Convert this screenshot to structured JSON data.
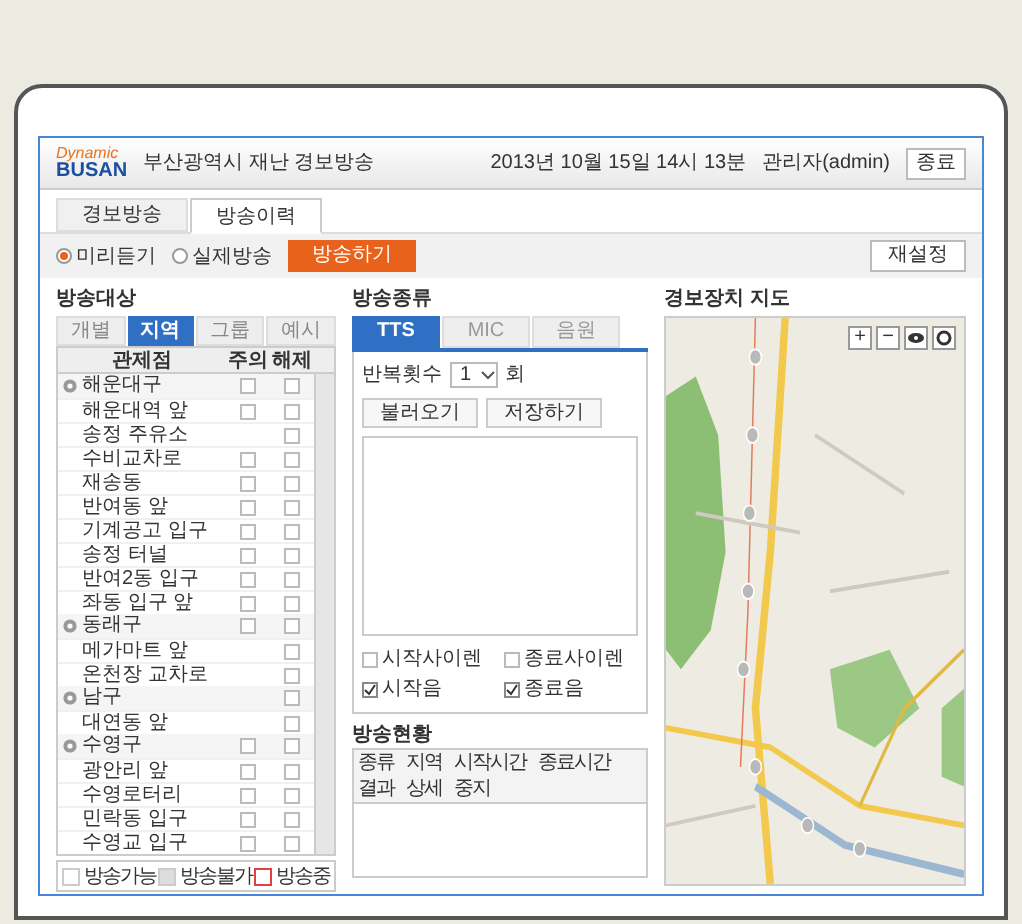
{
  "header": {
    "logo_top": "Dynamic",
    "logo_bottom": "BUSAN",
    "title": "부산광역시 재난 경보방송",
    "datetime": "2013년 10월 15일 14시 13분",
    "user": "관리자(admin)",
    "exit_button": "종료"
  },
  "tabs": [
    {
      "label": "경보방송",
      "selected": false
    },
    {
      "label": "방송이력",
      "selected": true
    }
  ],
  "mode_options": [
    {
      "label": "미리듣기",
      "selected": true
    },
    {
      "label": "실제방송",
      "selected": false
    }
  ],
  "broadcast_button": "방송하기",
  "reset_button": "재설정",
  "target": {
    "title": "방송대상",
    "tabs": [
      {
        "label": "개별",
        "selected": false
      },
      {
        "label": "지역",
        "selected": true
      },
      {
        "label": "그룹",
        "selected": false
      },
      {
        "label": "예시",
        "selected": false
      }
    ],
    "columns": [
      "관제점",
      "주의",
      "해제"
    ],
    "groups": [
      {
        "label": "해운대구",
        "checks": [
          false,
          false
        ],
        "children": [
          {
            "label": "해운대역 앞",
            "checks": [
              false,
              false
            ]
          },
          {
            "label": "송정 주유소",
            "checks": [
              false
            ]
          },
          {
            "label": "수비교차로",
            "checks": [
              false,
              false
            ]
          },
          {
            "label": "재송동",
            "checks": [
              false,
              false
            ]
          },
          {
            "label": "반여동 앞",
            "checks": [
              false,
              false
            ]
          },
          {
            "label": "기계공고 입구",
            "checks": [
              false,
              false
            ]
          },
          {
            "label": "송정 터널",
            "checks": [
              false,
              false
            ]
          },
          {
            "label": "반여2동 입구",
            "checks": [
              false,
              false
            ]
          },
          {
            "label": "좌동 입구 앞",
            "checks": [
              false,
              false
            ]
          }
        ]
      },
      {
        "label": "동래구",
        "checks": [
          false,
          false
        ],
        "children": [
          {
            "label": "메가마트 앞",
            "checks": [
              false
            ]
          },
          {
            "label": "온천장 교차로",
            "checks": [
              false
            ]
          }
        ]
      },
      {
        "label": "남구",
        "checks": [
          false
        ],
        "children": [
          {
            "label": "대연동 앞",
            "checks": [
              false
            ]
          }
        ]
      },
      {
        "label": "수영구",
        "checks": [
          false,
          false
        ],
        "children": [
          {
            "label": "광안리 앞",
            "checks": [
              false,
              false
            ]
          },
          {
            "label": "수영로터리",
            "checks": [
              false,
              false
            ]
          },
          {
            "label": "민락동 입구",
            "checks": [
              false,
              false
            ]
          },
          {
            "label": "수영교 입구",
            "checks": [
              false,
              false
            ]
          }
        ]
      }
    ]
  },
  "legend": [
    {
      "label": "방송가능",
      "kind": "fill",
      "color": "#ffffff"
    },
    {
      "label": "방송불가",
      "kind": "fill",
      "color": "#dddddd"
    },
    {
      "label": "방송중",
      "kind": "outline",
      "color": "#e04040"
    }
  ],
  "type": {
    "title": "방송종류",
    "tabs": [
      {
        "label": "TTS",
        "selected": true
      },
      {
        "label": "MIC",
        "selected": false
      },
      {
        "label": "음원",
        "selected": false
      }
    ],
    "repeat_label": "반복횟수",
    "repeat_value": "1",
    "repeat_unit": "회",
    "buttons": [
      "불러오기",
      "저장하기"
    ],
    "options": [
      {
        "label": "시작사이렌",
        "checked": false
      },
      {
        "label": "종료사이렌",
        "checked": false
      },
      {
        "label": "시작음",
        "checked": true
      },
      {
        "label": "종료음",
        "checked": true
      }
    ]
  },
  "status": {
    "title": "방송현황",
    "columns": [
      "종류",
      "지역",
      "시작시간",
      "종료시간",
      "결과",
      "상세",
      "중지"
    ]
  },
  "map": {
    "title": "경보장치 지도",
    "zoom_in": "+",
    "zoom_out": "−"
  }
}
